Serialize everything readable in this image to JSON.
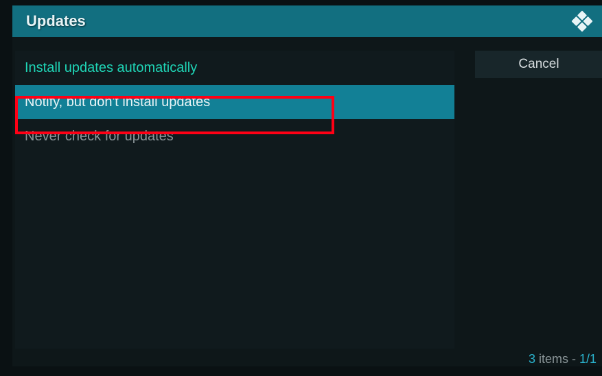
{
  "header": {
    "title": "Updates"
  },
  "options": {
    "install_auto": "Install updates automatically",
    "notify": "Notify, but don't install updates",
    "never": "Never check for updates"
  },
  "buttons": {
    "cancel": "Cancel"
  },
  "footer": {
    "count": "3",
    "items_text": " items - ",
    "page": "1/1"
  }
}
